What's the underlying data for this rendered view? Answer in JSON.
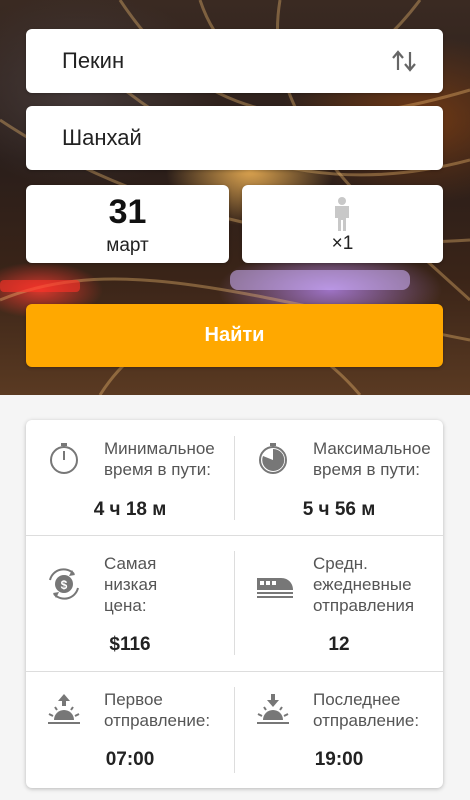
{
  "search": {
    "from_city": "Пекин",
    "to_city": "Шанхай",
    "date_day": "31",
    "date_month": "март",
    "passengers": "×1",
    "button_label": "Найти"
  },
  "stats": {
    "min_time": {
      "label": "Минимальное время в пути:",
      "line1": "Минимальное",
      "line2": "время в пути:",
      "value": "4 ч 18 м",
      "icon": "stopwatch-icon"
    },
    "max_time": {
      "label": "Максимальное время в пути:",
      "line1": "Максимальное",
      "line2": "время в пути:",
      "value": "5 ч 56 м",
      "icon": "stopwatch-filled-icon"
    },
    "lowest_price": {
      "line1": "Самая",
      "line2": "низкая",
      "line3": "цена:",
      "value": "$116",
      "icon": "dollar-cycle-icon"
    },
    "daily_departures": {
      "line1": "Средн.",
      "line2": "ежедневные",
      "line3": "отправления",
      "value": "12",
      "icon": "train-icon"
    },
    "first_departure": {
      "line1": "Первое",
      "line2": "отправление:",
      "value": "07:00",
      "icon": "sunrise-icon"
    },
    "last_departure": {
      "line1": "Последнее",
      "line2": "отправление:",
      "value": "19:00",
      "icon": "sunset-icon"
    }
  },
  "colors": {
    "accent": "#ffa800",
    "icon_gray": "#777777"
  }
}
